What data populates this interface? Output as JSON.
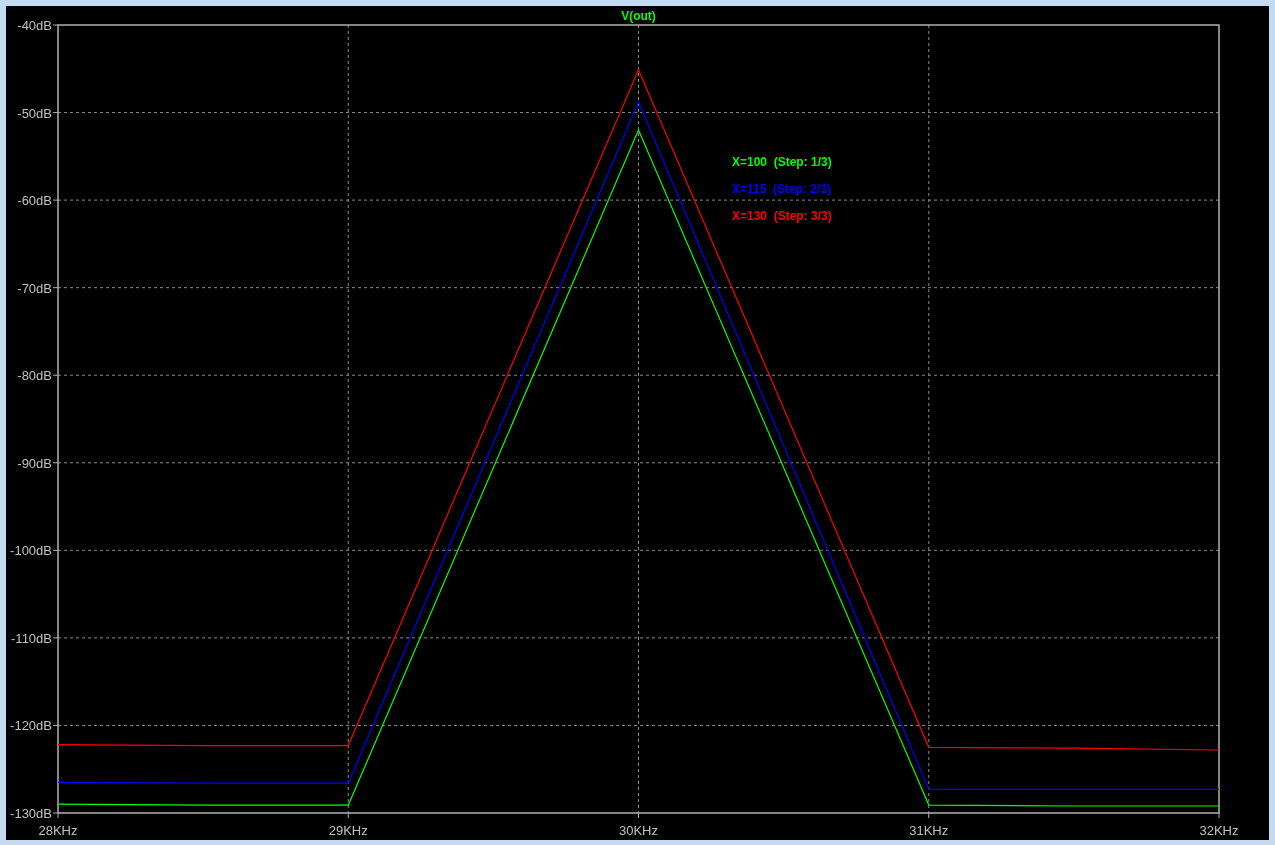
{
  "plot": {
    "chart_data": {
      "type": "line",
      "grid": true,
      "title": "V(out)",
      "x": [
        28,
        28.5,
        29,
        30,
        31,
        31.5,
        32
      ],
      "series": [
        {
          "name": "X=100  (Step: 1/3)",
          "color": "#00ff00",
          "values": [
            -129.0,
            -129.1,
            -129.1,
            -52,
            -129.1,
            -129.2,
            -129.2
          ]
        },
        {
          "name": "X=115  (Step: 2/3)",
          "color": "#0000ff",
          "values": [
            -126.5,
            -126.6,
            -126.6,
            -48.8,
            -127.3,
            -127.3,
            -127.3
          ]
        },
        {
          "name": "X=130  (Step: 3/3)",
          "color": "#ff0000",
          "values": [
            -122.2,
            -122.3,
            -122.3,
            -45.1,
            -122.5,
            -122.6,
            -122.8
          ]
        }
      ],
      "xlim": [
        28,
        32
      ],
      "ylim": [
        -130,
        -40
      ],
      "xticks": [
        {
          "value": 28,
          "label": "28KHz"
        },
        {
          "value": 29,
          "label": "29KHz"
        },
        {
          "value": 30,
          "label": "30KHz"
        },
        {
          "value": 31,
          "label": "31KHz"
        },
        {
          "value": 32,
          "label": "32KHz"
        }
      ],
      "yticks": [
        {
          "value": -40,
          "label": "-40dB"
        },
        {
          "value": -50,
          "label": "-50dB"
        },
        {
          "value": -60,
          "label": "-60dB"
        },
        {
          "value": -70,
          "label": "-70dB"
        },
        {
          "value": -80,
          "label": "-80dB"
        },
        {
          "value": -90,
          "label": "-90dB"
        },
        {
          "value": -100,
          "label": "-100dB"
        },
        {
          "value": -110,
          "label": "-110dB"
        },
        {
          "value": -120,
          "label": "-120dB"
        },
        {
          "value": -130,
          "label": "-130dB"
        }
      ]
    }
  }
}
